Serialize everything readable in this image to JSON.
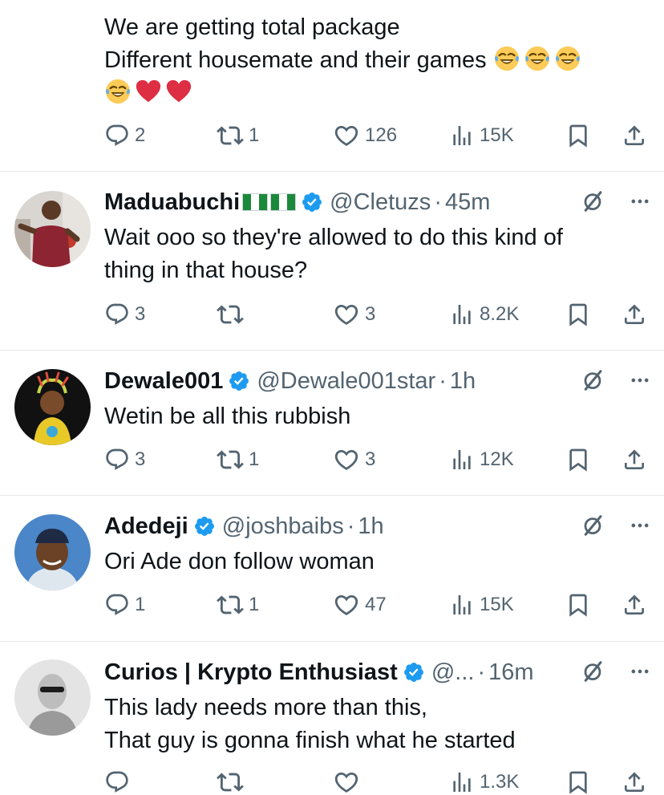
{
  "tweets": [
    {
      "partial": true,
      "lines": [
        "We are getting total package",
        "Different housemate and their games"
      ],
      "emoji_line1": [
        "rolling-laughing",
        "rolling-laughing",
        "rolling-laughing"
      ],
      "emoji_line2": [
        "rolling-laughing",
        "red-heart",
        "red-heart"
      ],
      "replies": "2",
      "retweets": "1",
      "likes": "126",
      "views": "15K"
    },
    {
      "name": "Maduabuchi",
      "flags": 2,
      "handle": "@Cletuzs",
      "time": "45m",
      "lines": [
        "Wait ooo so they're allowed to do this kind of",
        "thing in that house?"
      ],
      "replies": "3",
      "retweets": "",
      "likes": "3",
      "views": "8.2K"
    },
    {
      "name": "Dewale001",
      "handle": "@Dewale001star",
      "time": "1h",
      "lines": [
        "Wetin be all this rubbish"
      ],
      "replies": "3",
      "retweets": "1",
      "likes": "3",
      "views": "12K"
    },
    {
      "name": "Adedeji",
      "handle": "@joshbaibs",
      "time": "1h",
      "lines": [
        "Ori Ade don follow woman"
      ],
      "replies": "1",
      "retweets": "1",
      "likes": "47",
      "views": "15K"
    },
    {
      "name": "Curios | Krypto Enthusiast",
      "handle": "@...",
      "time": "16m",
      "lines": [
        "This lady needs more than this,",
        "That guy is gonna finish what he started"
      ],
      "replies": "",
      "retweets": "",
      "likes": "",
      "views": "1.3K"
    }
  ],
  "icons": [
    "reply-icon",
    "retweet-icon",
    "like-icon",
    "views-icon",
    "bookmark-icon",
    "share-icon",
    "verified-badge-icon",
    "grok-icon",
    "more-icon"
  ],
  "colors": {
    "verified": "#1d9bf0",
    "text": "#0f1419",
    "muted": "#536471",
    "divider": "#e6e9eb"
  }
}
